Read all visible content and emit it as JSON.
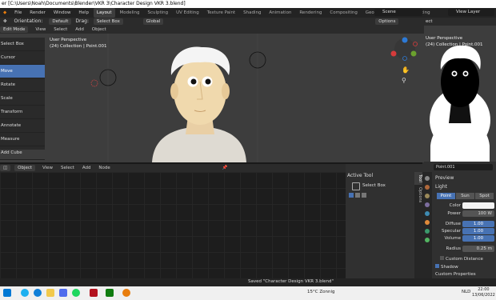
{
  "titlebar": {
    "title": "er [C:\\Users\\Noah\\Documents\\Blender\\VKR 3\\Character Design VKR 3.blend]"
  },
  "topbar": {
    "menus": [
      "File",
      "Render",
      "Window",
      "Help"
    ],
    "tabs": [
      "Layout",
      "Modeling",
      "Sculpting",
      "UV Editing",
      "Texture Paint",
      "Shading",
      "Animation",
      "Rendering",
      "Compositing",
      "Geometry Nodes",
      "Scripting"
    ],
    "active_tab": "Layout",
    "scene": "Scene",
    "view_layer": "View Layer"
  },
  "toolbar3d": {
    "orientation_label": "Orientation:",
    "orientation_value": "Default",
    "drag_label": "Drag:",
    "drag_value": "Select Box",
    "transform_value": "Global",
    "options": "Options"
  },
  "header3d": {
    "mode": "Edit Mode",
    "menus": [
      "View",
      "Select",
      "Add",
      "Object"
    ]
  },
  "viewport": {
    "perspective": "User Perspective",
    "collection": "(24) Collection | Point.001"
  },
  "vp_tools": [
    "Select Box",
    "Cursor",
    "Move",
    "Rotate",
    "Scale",
    "Transform",
    "Annotate",
    "Measure",
    "Add Cube"
  ],
  "vp_tools_active": "Move",
  "right_panel": {
    "header": "ect",
    "perspective": "User Perspective",
    "collection": "(24) Collection | Point.001"
  },
  "node_editor": {
    "type": "Object",
    "menus": [
      "View",
      "Select",
      "Add",
      "Node"
    ]
  },
  "active_tool": {
    "title": "Active Tool",
    "tool": "Select Box"
  },
  "side_tabs": [
    "Tool",
    "Options"
  ],
  "properties": {
    "object": "Point.001",
    "preview": "Preview",
    "light": "Light",
    "light_types": [
      "Point",
      "Sun",
      "Spot"
    ],
    "light_type_active": "Point",
    "rows": [
      {
        "label": "Color",
        "value": ""
      },
      {
        "label": "Power",
        "value": "100 W"
      },
      {
        "label": "Diffuse",
        "value": "1.00"
      },
      {
        "label": "Specular",
        "value": "1.00"
      },
      {
        "label": "Volume",
        "value": "1.00"
      },
      {
        "label": "Radius",
        "value": "0.25 m"
      }
    ],
    "custom_distance": "Custom Distance",
    "shadow": "Shadow",
    "custom_properties": "Custom Properties"
  },
  "statusbar": {
    "message": "Saved \"Character Design VKR 3.blend\""
  },
  "taskbar": {
    "weather": "15°C  Zonnig",
    "lang": "NLD",
    "time": "22:00",
    "date": "13/06/2022"
  },
  "colors": {
    "accent": "#4772b3",
    "orange": "#e87d0d"
  }
}
